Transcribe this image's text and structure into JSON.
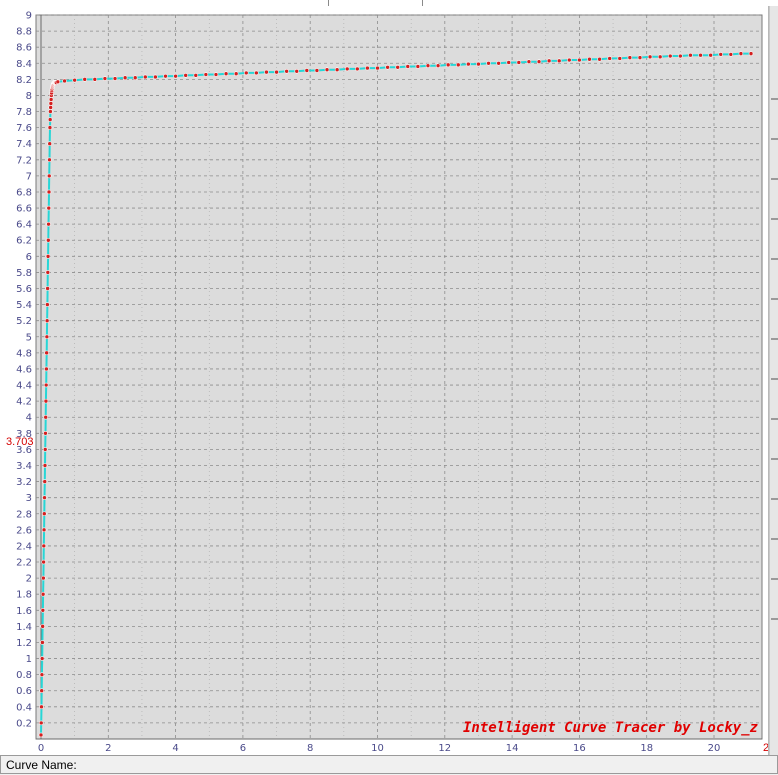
{
  "window": {
    "curve_name_label": "Curve Name:",
    "watermark": "Intelligent Curve Tracer by Locky_z",
    "cursor_y_label": "3.703",
    "right_edge_label": "2’"
  },
  "colors": {
    "plot_bg": "#dcdcdc",
    "grid": "#8c8c8c",
    "curve": "#27d6d6",
    "points": "#d42020",
    "tick_text": "#4a4a8a"
  },
  "chart_data": {
    "type": "line",
    "title": "",
    "xlabel": "",
    "ylabel": "",
    "xlim": [
      0,
      21.2
    ],
    "ylim": [
      0,
      9
    ],
    "grid": true,
    "x_ticks": [
      "0",
      "2",
      "4",
      "6",
      "8",
      "10",
      "12",
      "14",
      "16",
      "18",
      "20"
    ],
    "y_ticks": [
      "0.2",
      "0.4",
      "0.6",
      "0.8",
      "1",
      "1.2",
      "1.4",
      "1.6",
      "1.8",
      "2",
      "2.2",
      "2.4",
      "2.6",
      "2.8",
      "3",
      "3.2",
      "3.4",
      "3.6",
      "3.8",
      "4",
      "4.2",
      "4.4",
      "4.6",
      "4.8",
      "5",
      "5.2",
      "5.4",
      "5.6",
      "5.8",
      "6",
      "6.2",
      "6.4",
      "6.6",
      "6.8",
      "7",
      "7.2",
      "7.4",
      "7.6",
      "7.8",
      "8",
      "8.2",
      "8.4",
      "8.6",
      "8.8",
      "9"
    ],
    "series": [
      {
        "x": [
          0,
          0.007,
          0.014,
          0.021,
          0.028,
          0.035,
          0.042,
          0.049,
          0.056,
          0.063,
          0.07,
          0.077,
          0.084,
          0.091,
          0.098,
          0.105,
          0.112,
          0.119,
          0.126,
          0.133,
          0.14,
          0.147,
          0.154,
          0.161,
          0.168,
          0.175,
          0.182,
          0.189,
          0.196,
          0.203,
          0.21,
          0.217,
          0.224,
          0.231,
          0.238,
          0.245,
          0.252,
          0.259,
          0.266,
          0.273,
          0.28,
          0.287,
          0.294,
          0.301,
          0.308,
          0.315,
          0.322,
          0.329,
          0.336,
          0.343,
          0.35,
          0.357,
          0.364,
          0.371,
          0.378,
          0.385,
          0.392,
          0.399,
          0.406,
          0.413,
          0.42,
          0.427,
          0.434,
          0.441,
          0.448,
          0.455,
          0.5,
          0.7,
          1.0,
          1.3,
          1.6,
          1.9,
          2.2,
          2.5,
          2.8,
          3.1,
          3.4,
          3.7,
          4.0,
          4.3,
          4.6,
          4.9,
          5.2,
          5.5,
          5.8,
          6.1,
          6.4,
          6.7,
          7.0,
          7.3,
          7.6,
          7.9,
          8.2,
          8.5,
          8.8,
          9.1,
          9.4,
          9.7,
          10.0,
          10.3,
          10.6,
          10.9,
          11.2,
          11.5,
          11.8,
          12.1,
          12.4,
          12.7,
          13.0,
          13.3,
          13.6,
          13.9,
          14.2,
          14.5,
          14.8,
          15.1,
          15.4,
          15.7,
          16.0,
          16.3,
          16.6,
          16.9,
          17.2,
          17.5,
          17.8,
          18.1,
          18.4,
          18.7,
          19.0,
          19.3,
          19.6,
          19.9,
          20.2,
          20.5,
          20.8,
          21.1
        ],
        "y": [
          0.05,
          0.2,
          0.4,
          0.6,
          0.8,
          1.0,
          1.2,
          1.4,
          1.6,
          1.8,
          2.0,
          2.2,
          2.4,
          2.6,
          2.8,
          3.0,
          3.2,
          3.4,
          3.6,
          3.8,
          4.0,
          4.2,
          4.4,
          4.6,
          4.8,
          5.0,
          5.2,
          5.4,
          5.6,
          5.8,
          6.0,
          6.2,
          6.4,
          6.6,
          6.8,
          7.0,
          7.2,
          7.4,
          7.6,
          7.7,
          7.8,
          7.85,
          7.9,
          7.95,
          8.0,
          8.03,
          8.06,
          8.08,
          8.1,
          8.11,
          8.12,
          8.13,
          8.14,
          8.15,
          8.15,
          8.16,
          8.16,
          8.16,
          8.16,
          8.16,
          8.16,
          8.16,
          8.16,
          8.16,
          8.16,
          8.16,
          8.17,
          8.18,
          8.19,
          8.2,
          8.2,
          8.21,
          8.21,
          8.22,
          8.22,
          8.23,
          8.23,
          8.24,
          8.24,
          8.25,
          8.25,
          8.26,
          8.26,
          8.27,
          8.27,
          8.28,
          8.28,
          8.29,
          8.29,
          8.3,
          8.3,
          8.31,
          8.31,
          8.32,
          8.32,
          8.33,
          8.33,
          8.34,
          8.34,
          8.35,
          8.35,
          8.36,
          8.36,
          8.37,
          8.37,
          8.38,
          8.38,
          8.39,
          8.39,
          8.4,
          8.4,
          8.41,
          8.41,
          8.42,
          8.42,
          8.43,
          8.43,
          8.44,
          8.44,
          8.45,
          8.45,
          8.46,
          8.46,
          8.47,
          8.47,
          8.48,
          8.48,
          8.49,
          8.49,
          8.5,
          8.5,
          8.5,
          8.51,
          8.51,
          8.52,
          8.52
        ]
      }
    ]
  }
}
